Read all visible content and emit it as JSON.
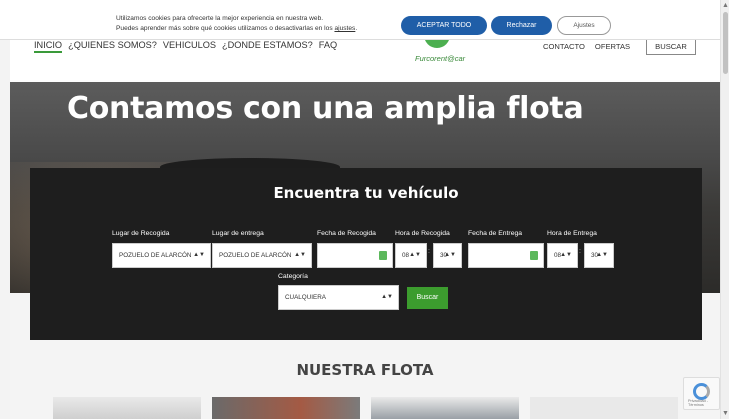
{
  "cookie": {
    "line1": "Utilizamos cookies para ofrecerte la mejor experiencia en nuestra web.",
    "line2_pre": "Puedes aprender más sobre qué cookies utilizamos o desactivarlas en los ",
    "line2_link": "ajustes",
    "line2_post": ".",
    "accept": "ACEPTAR TODO",
    "reject": "Rechazar",
    "adjust": "Ajustes"
  },
  "nav": {
    "left": [
      "INICIO",
      "¿QUIENES SOMOS?",
      "VEHICULOS",
      "¿DONDE ESTAMOS?",
      "FAQ"
    ],
    "right": [
      "CONTACTO",
      "OFERTAS"
    ],
    "search_button": "BUSCAR",
    "logo_text": "Furcorent@car"
  },
  "hero": {
    "title": "Contamos con una amplia flota"
  },
  "search": {
    "title": "Encuentra tu vehículo",
    "pickup_place_label": "Lugar de Recogida",
    "pickup_place_value": "POZUELO DE ALARCÓN",
    "dropoff_place_label": "Lugar de entrega",
    "dropoff_place_value": "POZUELO DE ALARCÓN",
    "pickup_date_label": "Fecha de Recogida",
    "pickup_time_label": "Hora de Recogida",
    "pickup_hour": "08",
    "pickup_min": "30",
    "dropoff_date_label": "Fecha de Entrega",
    "dropoff_time_label": "Hora de Entrega",
    "dropoff_hour": "08",
    "dropoff_min": "30",
    "category_label": "Categoría",
    "category_value": "CUALQUIERA",
    "submit": "Buscar"
  },
  "fleet": {
    "title": "NUESTRA FLOTA"
  },
  "recaptcha": {
    "text": "Privacidad - Términos"
  },
  "icons": {
    "calendar": "calendar-icon",
    "updown": "up-down-icon",
    "recaptcha": "recaptcha-icon"
  },
  "colors": {
    "accent_blue": "#1f5ea8",
    "accent_green": "#3c9c2e",
    "panel_bg": "#1e1e1e"
  }
}
